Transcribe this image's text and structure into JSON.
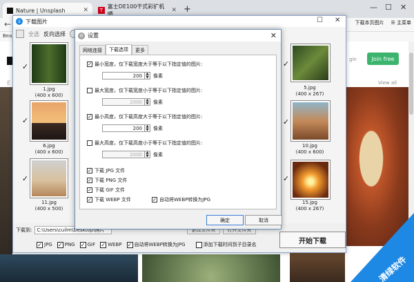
{
  "browser": {
    "tabs": [
      {
        "title": "Nature | Unsplash",
        "active": true
      },
      {
        "title": "富士DE100干式彩扩机晒",
        "active": false
      }
    ],
    "bookmark_prefix": "Bea",
    "toolbar_items": [
      "下载本页图片",
      "主菜单"
    ]
  },
  "webpage": {
    "login": "gin",
    "join_button": "Join free",
    "view_all": "View all",
    "accent": "#3cb46e"
  },
  "app": {
    "title": "下载图片",
    "toolbar": {
      "select_all": "全选",
      "invert_selection": "反向选择"
    },
    "thumbnails": [
      {
        "name": "1.jpg",
        "size": "(400 x 600)",
        "checked": true
      },
      {
        "name": "6.jpg",
        "size": "(400 x 600)",
        "checked": true
      },
      {
        "name": "11.jpg",
        "size": "(400 x 500)",
        "checked": true
      },
      {
        "name": "5.jpg",
        "size": "(400 x 267)",
        "checked": true
      },
      {
        "name": "10.jpg",
        "size": "(400 x 600)",
        "checked": true
      },
      {
        "name": "15.jpg",
        "size": "(400 x 267)",
        "checked": true
      }
    ],
    "download_to_label": "下载到:",
    "download_path": "C:\\Users\\cuilm\\Desktop\\照片",
    "change_folder_button": "更改文件夹",
    "open_folder_button": "打开文件夹",
    "filters": [
      {
        "label": "JPG",
        "checked": true
      },
      {
        "label": "PNG",
        "checked": true
      },
      {
        "label": "GIF",
        "checked": true
      },
      {
        "label": "WEBP",
        "checked": true
      },
      {
        "label": "自动将WEBP转换为JPG",
        "checked": true
      },
      {
        "label": "添加下载时间到子目录名",
        "checked": false
      }
    ],
    "start_button": "开始下载"
  },
  "settings": {
    "title": "设置",
    "tabs": [
      {
        "label": "网络连接",
        "selected": false
      },
      {
        "label": "下载选项",
        "selected": true
      },
      {
        "label": "更多",
        "selected": false
      }
    ],
    "options": [
      {
        "label": "最小宽度，仅下载宽度大于等于以下指定值的图片:",
        "checked": true,
        "value": "200",
        "unit": "像素",
        "enabled": true
      },
      {
        "label": "最大宽度，仅下载宽度小于等于以下指定值的图片:",
        "checked": false,
        "value": "2000",
        "unit": "像素",
        "enabled": false
      },
      {
        "label": "最小高度，仅下载高度大于等于以下指定值的图片:",
        "checked": true,
        "value": "200",
        "unit": "像素",
        "enabled": true
      },
      {
        "label": "最大高度，仅下载高度小于等于以下指定值的图片:",
        "checked": false,
        "value": "2000",
        "unit": "像素",
        "enabled": false
      }
    ],
    "file_types": [
      {
        "label": "下载 JPG 文件",
        "checked": true
      },
      {
        "label": "下载 PNG 文件",
        "checked": true
      },
      {
        "label": "下载 GIF 文件",
        "checked": true
      },
      {
        "label": "下载 WEBP 文件",
        "checked": true
      }
    ],
    "webp_convert": {
      "label": "自动将WEBP转换为JPG",
      "checked": true
    },
    "ok_button": "确定",
    "cancel_button": "取消"
  },
  "watermark": {
    "text": "清绿软件"
  }
}
